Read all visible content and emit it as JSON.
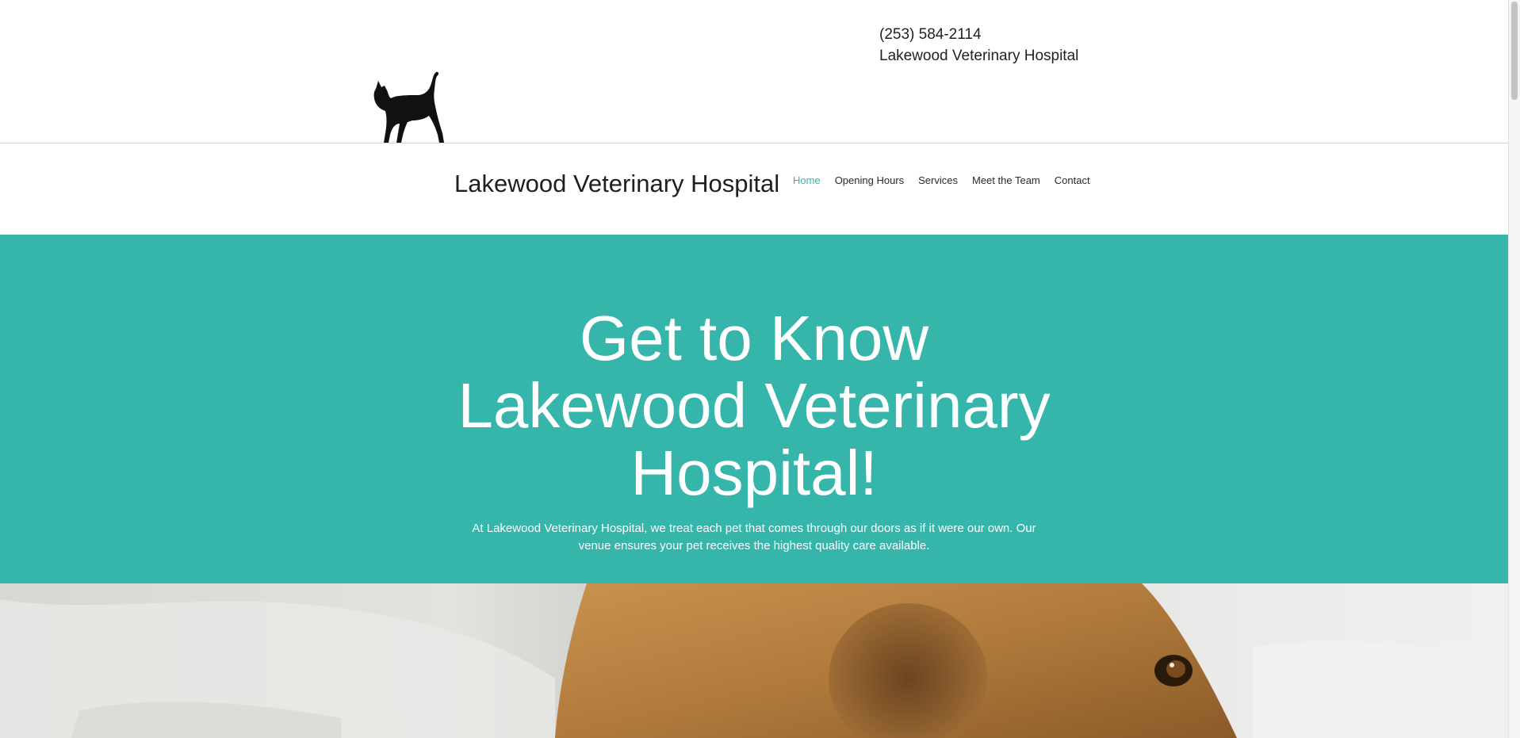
{
  "header": {
    "phone": "(253) 584-2114",
    "business_name": "Lakewood Veterinary Hospital",
    "logo_icon": "cat-silhouette-icon"
  },
  "nav": {
    "site_title": "Lakewood Veterinary Hospital",
    "items": [
      {
        "label": "Home",
        "active": true
      },
      {
        "label": "Opening Hours",
        "active": false
      },
      {
        "label": "Services",
        "active": false
      },
      {
        "label": "Meet the Team",
        "active": false
      },
      {
        "label": "Contact",
        "active": false
      }
    ]
  },
  "hero": {
    "title": "Get to Know Lakewood Veterinary Hospital!",
    "subtitle": "At Lakewood Veterinary Hospital, we treat each pet that comes through our doors as if it were our own. Our venue ensures your pet receives the highest quality care available."
  },
  "colors": {
    "accent": "#36b5ab",
    "hero_background": "#36b5ab",
    "text": "#1f1f1f"
  }
}
